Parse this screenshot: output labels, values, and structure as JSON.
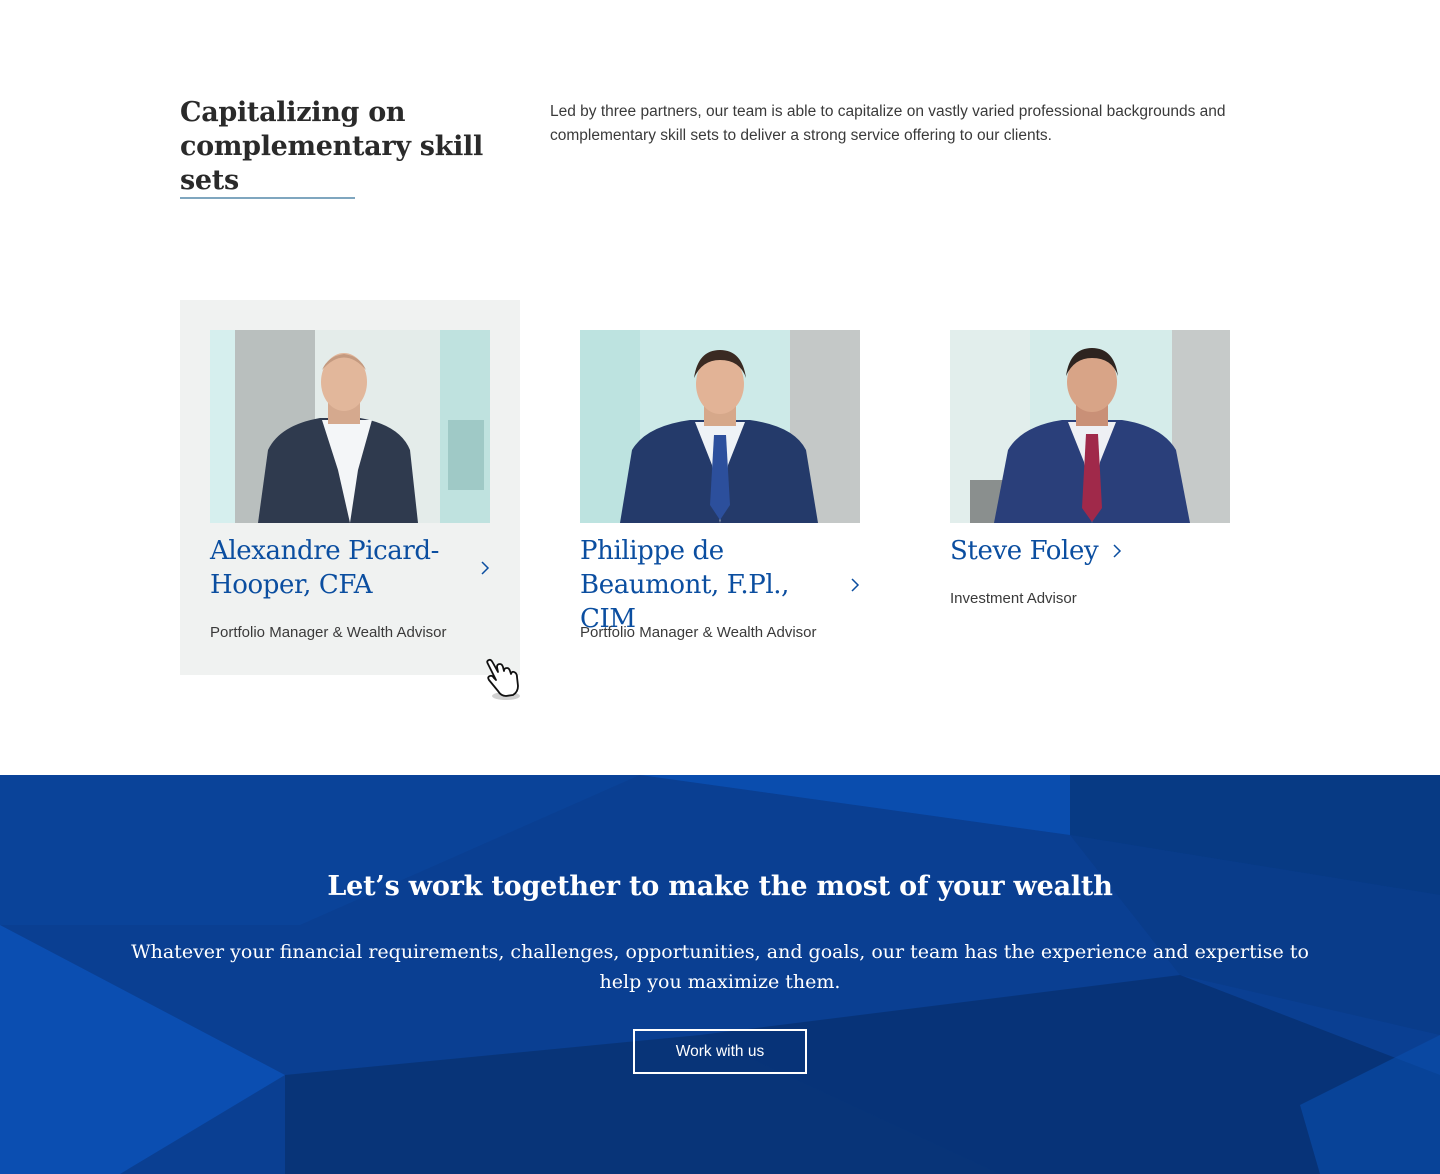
{
  "intro": {
    "title": "Capitalizing on complementary skill sets",
    "text": "Led by three partners, our team is able to capitalize on vastly varied professional backgrounds and complementary skill sets to deliver a strong service offering to our clients."
  },
  "team": [
    {
      "name": "Alexandre Picard-Hooper, CFA",
      "role": "Portfolio Manager & Wealth Advisor"
    },
    {
      "name": "Philippe de Beaumont, F.Pl., CIM",
      "role": "Portfolio Manager & Wealth Advisor"
    },
    {
      "name": "Steve Foley",
      "role": "Investment Advisor"
    }
  ],
  "cta": {
    "title": "Let’s work together to make the most of your wealth",
    "text": "Whatever your financial requirements, challenges, opportunities, and goals, our team has the experience and expertise to help you maximize them.",
    "button_label": "Work with us"
  },
  "colors": {
    "name_link": "#0b4ea0",
    "rule": "#7fa6bf",
    "card_hover": "#f0f2f1",
    "banner": "#0a3e8f"
  }
}
